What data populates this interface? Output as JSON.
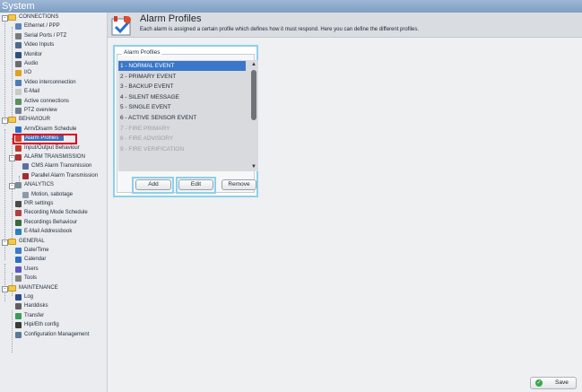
{
  "window": {
    "title": "System"
  },
  "sidebar": {
    "items": [
      {
        "label": "CONNECTIONS",
        "icon": "folder-icon",
        "level": 0,
        "type": "folder"
      },
      {
        "label": "Ethernet / PPP",
        "icon": "network-icon",
        "level": 1
      },
      {
        "label": "Serial Ports / PTZ",
        "icon": "serial-port-icon",
        "level": 1
      },
      {
        "label": "Video Inputs",
        "icon": "video-input-icon",
        "level": 1
      },
      {
        "label": "Monitor",
        "icon": "monitor-icon",
        "level": 1
      },
      {
        "label": "Audio",
        "icon": "audio-icon",
        "level": 1
      },
      {
        "label": "I/O",
        "icon": "io-icon",
        "level": 1
      },
      {
        "label": "Video interconnection",
        "icon": "video-interconnect-icon",
        "level": 1
      },
      {
        "label": "E-Mail",
        "icon": "email-icon",
        "level": 1
      },
      {
        "label": "Active connections",
        "icon": "connections-icon",
        "level": 1
      },
      {
        "label": "PTZ overview",
        "icon": "ptz-icon",
        "level": 1
      },
      {
        "label": "BEHAVIOUR",
        "icon": "folder-icon",
        "level": 0,
        "type": "folder"
      },
      {
        "label": "Arm/Disarm Schedule",
        "icon": "calendar-icon",
        "level": 1
      },
      {
        "label": "Alarm Profiles",
        "icon": "alarm-profile-icon",
        "level": 1,
        "selected": true
      },
      {
        "label": "Input/Output Behaviour",
        "icon": "io-behaviour-icon",
        "level": 1
      },
      {
        "label": "ALARM TRANSMISSION",
        "icon": "alarm-transmission-icon",
        "level": 1,
        "type": "group"
      },
      {
        "label": "CMS Alarm Transmission",
        "icon": "cms-icon",
        "level": 2
      },
      {
        "label": "Parallel Alarm Transmission",
        "icon": "parallel-alarm-icon",
        "level": 2
      },
      {
        "label": "ANALYTICS",
        "icon": "analytics-icon",
        "level": 1,
        "type": "group"
      },
      {
        "label": "Motion, sabotage",
        "icon": "motion-icon",
        "level": 2
      },
      {
        "label": "PIR settings",
        "icon": "pir-icon",
        "level": 1
      },
      {
        "label": "Recording Mode Schedule",
        "icon": "recording-schedule-icon",
        "level": 1
      },
      {
        "label": "Recordings Behaviour",
        "icon": "recordings-icon",
        "level": 1
      },
      {
        "label": "E-Mail Addressbook",
        "icon": "addressbook-icon",
        "level": 1
      },
      {
        "label": "GENERAL",
        "icon": "folder-icon",
        "level": 0,
        "type": "folder"
      },
      {
        "label": "Date/Time",
        "icon": "clock-icon",
        "level": 1
      },
      {
        "label": "Calendar",
        "icon": "calendar-icon",
        "level": 1
      },
      {
        "label": "Users",
        "icon": "users-icon",
        "level": 1
      },
      {
        "label": "Tools",
        "icon": "tools-icon",
        "level": 1
      },
      {
        "label": "MAINTENANCE",
        "icon": "folder-icon",
        "level": 0,
        "type": "folder"
      },
      {
        "label": "Log",
        "icon": "log-icon",
        "level": 1
      },
      {
        "label": "Harddisks",
        "icon": "harddisk-icon",
        "level": 1
      },
      {
        "label": "Transfer",
        "icon": "transfer-icon",
        "level": 1
      },
      {
        "label": "Hipi/Eth config",
        "icon": "config-icon",
        "level": 1
      },
      {
        "label": "Configuration Management",
        "icon": "config-management-icon",
        "level": 1
      }
    ]
  },
  "header": {
    "title": "Alarm Profiles",
    "description": "Each alarm is assigned a certain profile which defines how it must respond. Here you can define the different profiles.",
    "icon": "alarm-profile-icon"
  },
  "profiles": {
    "group_title": "Alarm Profiles",
    "items": [
      {
        "label": "1 - NORMAL EVENT",
        "state": "selected"
      },
      {
        "label": "2 - PRIMARY EVENT",
        "state": "normal"
      },
      {
        "label": "3 - BACKUP EVENT",
        "state": "normal"
      },
      {
        "label": "4 - SILENT MESSAGE",
        "state": "normal"
      },
      {
        "label": "5 - SINGLE EVENT",
        "state": "normal"
      },
      {
        "label": "6 - ACTIVE SENSOR EVENT",
        "state": "normal"
      },
      {
        "label": "7 - FIRE PRIMARY",
        "state": "disabled"
      },
      {
        "label": "8 - FIRE ADVISORY",
        "state": "disabled"
      },
      {
        "label": "9 - FIRE VERIFICATION",
        "state": "disabled"
      }
    ],
    "buttons": {
      "add": "Add",
      "edit": "Edit",
      "remove": "Remove"
    }
  },
  "footer": {
    "save_label": "Save"
  },
  "colors": {
    "title_bar": "#8aa6c8",
    "selection": "#3a77c9",
    "highlight_border": "#8ed0ea",
    "sidebar_selection_border": "#e0001b",
    "folder": "#f2c94c"
  }
}
